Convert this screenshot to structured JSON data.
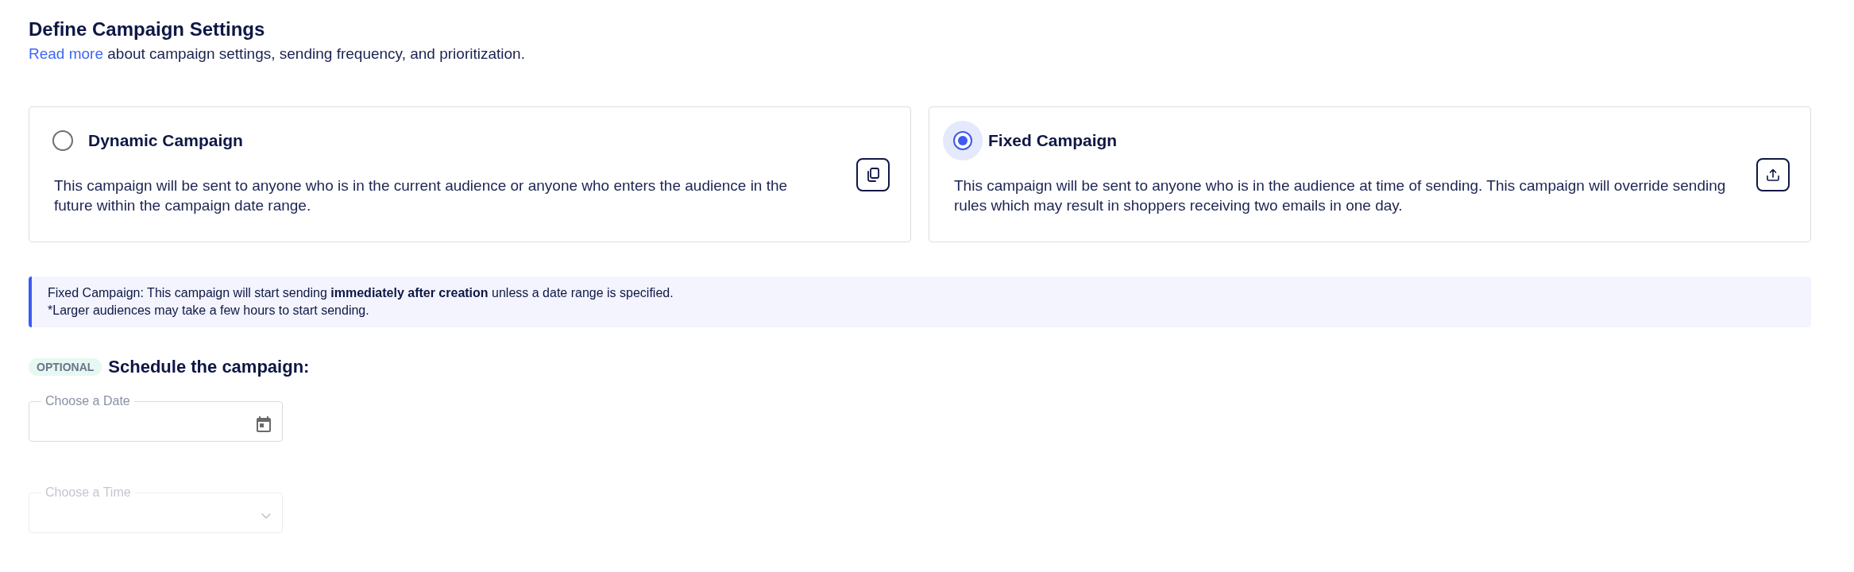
{
  "header": {
    "title": "Define Campaign Settings",
    "intro": {
      "link": "Read more",
      "text": "about campaign settings, sending frequency, and prioritization."
    }
  },
  "campaign_types": [
    {
      "kind": "dynamic",
      "title": "Dynamic Campaign",
      "description": "This campaign will be sent to anyone who is in the current audience or anyone who enters the audience in the future within the campaign date range.",
      "selected": false
    },
    {
      "kind": "fixed",
      "title": "Fixed Campaign",
      "description": "This campaign will be sent to anyone who is in the audience at time of sending. This campaign will override sending rules which may result in shoppers receiving two emails in one day.",
      "selected": true
    }
  ],
  "notice": {
    "lines": [
      "Fixed Campaign: This campaign will start sending **immediately after creation** unless a date range is specified.",
      "*Larger audiences may take a few hours to start sending."
    ]
  },
  "schedule": {
    "badge": "OPTIONAL",
    "title": "Schedule the campaign:",
    "fields": [
      {
        "kind": "date",
        "label": "Choose a Date",
        "disabled": false
      },
      {
        "kind": "time",
        "label": "Choose a Time",
        "disabled": true
      }
    ]
  }
}
